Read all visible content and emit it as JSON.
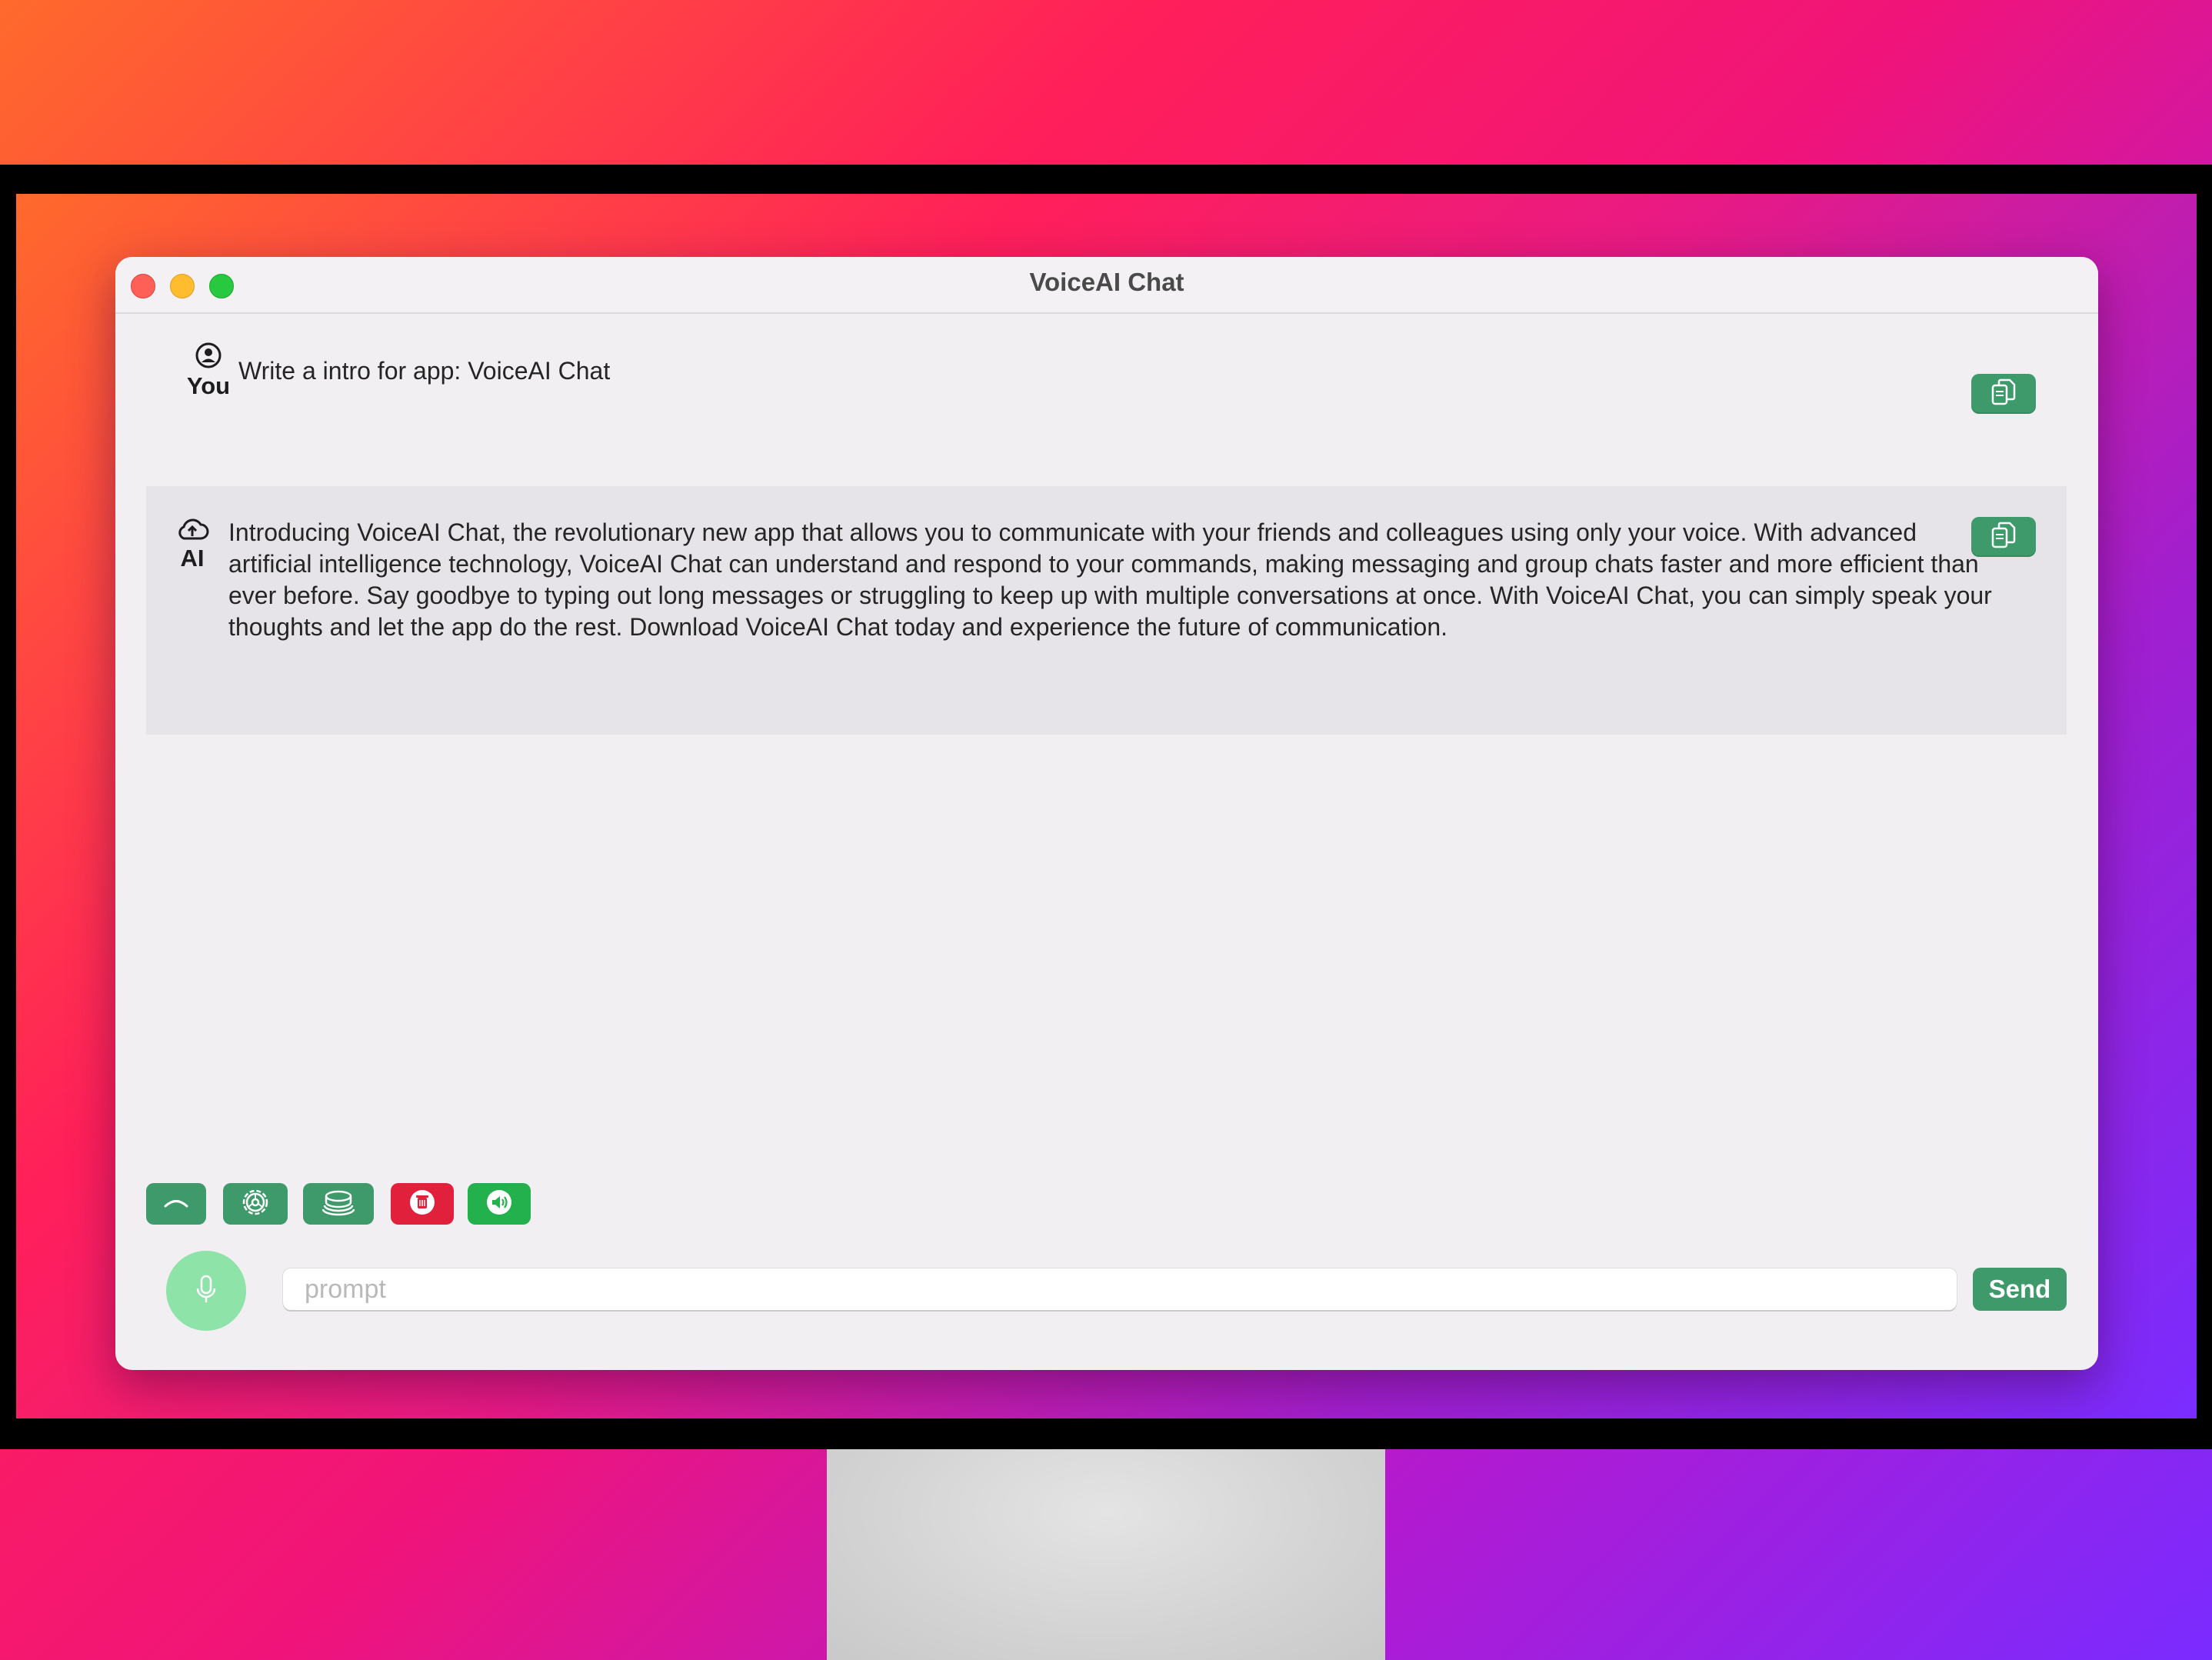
{
  "window": {
    "title": "VoiceAI Chat"
  },
  "messages": [
    {
      "role_label": "You",
      "role_icon": "person-circle-icon",
      "text": "Write a intro for app: VoiceAI Chat",
      "copy_icon": "copy-icon"
    },
    {
      "role_label": "AI",
      "role_icon": "cloud-icon",
      "text": "Introducing VoiceAI Chat, the revolutionary new app that allows you to communicate with your friends and colleagues using only your voice. With advanced artificial intelligence technology, VoiceAI Chat can understand and respond to your commands, making messaging and group chats faster and more efficient than ever before. Say goodbye to typing out long messages or struggling to keep up with multiple conversations at once. With VoiceAI Chat, you can simply speak your thoughts and let the app do the rest. Download VoiceAI Chat today and experience the future of communication.",
      "copy_icon": "copy-icon"
    }
  ],
  "toolbar": {
    "buttons": [
      {
        "icon": "chevron-up-icon",
        "color": "#3e9a6a"
      },
      {
        "icon": "gear-icon",
        "color": "#3e9a6a"
      },
      {
        "icon": "history-stack-icon",
        "color": "#3e9a6a"
      },
      {
        "icon": "trash-icon",
        "color": "#e1213b"
      },
      {
        "icon": "speaker-icon",
        "color": "#22b14c"
      }
    ]
  },
  "input": {
    "placeholder": "prompt",
    "value": "",
    "mic_icon": "microphone-icon",
    "send_label": "Send"
  },
  "colors": {
    "accent": "#3e9a6a",
    "danger": "#e1213b",
    "speaker": "#22b14c",
    "mic": "#8de3a8"
  }
}
